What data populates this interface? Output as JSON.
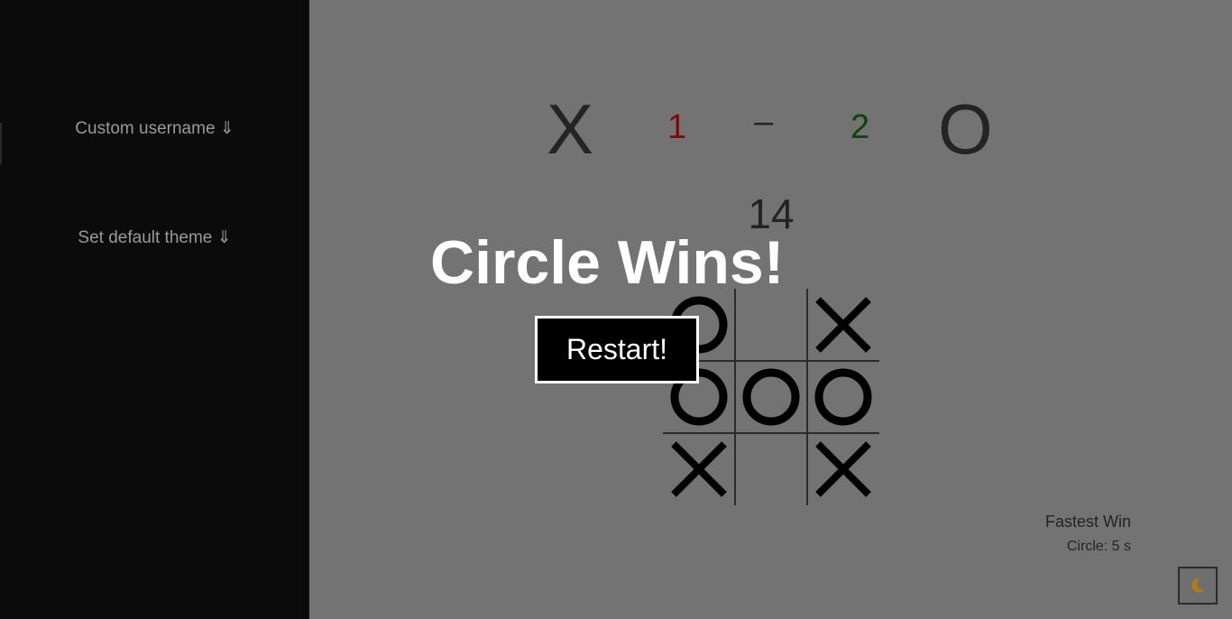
{
  "sidebar": {
    "items": [
      {
        "label": "Custom username ⇓"
      },
      {
        "label": "Set default theme ⇓"
      }
    ]
  },
  "scoreboard": {
    "player_x": "X",
    "score_x": "1",
    "separator": "–",
    "score_o": "2",
    "player_o": "O"
  },
  "timer": "14",
  "board": {
    "cells": [
      "O",
      "",
      "X",
      "O",
      "O",
      "O",
      "X",
      "",
      "X"
    ]
  },
  "overlay": {
    "title": "Circle Wins!",
    "restart_label": "Restart!"
  },
  "fastest_win": {
    "title": "Fastest Win",
    "record": "Circle: 5 s"
  },
  "theme_toggle": {
    "icon": "moon-icon"
  },
  "colors": {
    "background": "#737373",
    "sidebar": "#0b0b0b",
    "score_x": "#7a0c0c",
    "score_o": "#0f4210",
    "moon": "#b07d1a"
  }
}
